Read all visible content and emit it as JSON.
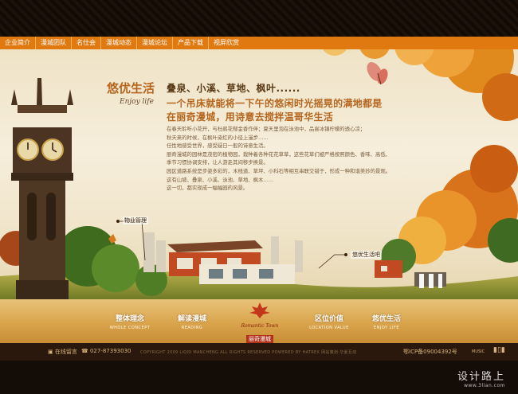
{
  "nav": {
    "items": [
      "企业简介",
      "漫城团队",
      "名仕会",
      "漫城动态",
      "漫城论坛",
      "产品下载",
      "视屏欣赏"
    ]
  },
  "section": {
    "title_cn": "悠优生活",
    "title_en": "Enjoy life"
  },
  "headline": "叠泉、小溪、草地、枫叶......",
  "subheadline": [
    "一个吊床就能将一下午的悠闲时光摇晃的满地都是",
    "在丽奇漫城，用诗意去搅拌温哥华生活"
  ],
  "body": [
    "在春天聆听小花开，与杜鹃花郁金香作伴；夏天里泡在泳池中，品尝冰镇柠檬的透心凉；",
    "秋天来的时候，在枫叶染红的小径上漫步……",
    "任性地感受世界，感受疑日一般的诗意生活。",
    "丽奇漫城的园林是茂密的植物园，栽种着各种花花草草，这些花草们被严格按照颜色、香味、高低、",
    "季节习惯协调安排，让人游走其间移步换景。",
    "园区道路系统是步姿多彩的，木栈道、草坪、小科石等相互串联交错于，形成一种和谐美妙的景观。",
    "这有山坡、叠泉、小溪、泳池、草地、枫木……",
    "这一切，都实现成一幅幅园的风景。"
  ],
  "callouts": {
    "property": "物业管理",
    "leisure": "悠优生活吧"
  },
  "bottom_menu": [
    {
      "cn": "整体理念",
      "en": "WHOLE CONCEPT"
    },
    {
      "cn": "解读漫城",
      "en": "READING"
    },
    {
      "cn": "区位价值",
      "en": "LOCATION VALUE"
    },
    {
      "cn": "悠优生活",
      "en": "ENJOY LIFE"
    }
  ],
  "logo": {
    "brand_en": "Romantic Town",
    "brand_cn": "丽奇漫城"
  },
  "footer": {
    "online": "在线留言",
    "phone": "027-87393030",
    "copyright": "COPYRIGHT 2009 LIQID MANCHENG ALL RIGHTS RESERVED POWERED BY HATREX 网站策划·华夏互动",
    "icp": "鄂ICP备09004392号",
    "music": "MUSIC"
  },
  "watermark": {
    "cn": "设计路上",
    "url": "www.3lian.com"
  },
  "colors": {
    "nav_bg": "#e07a10",
    "accent": "#b5651d",
    "bottom_bar": "#d9a44c"
  }
}
